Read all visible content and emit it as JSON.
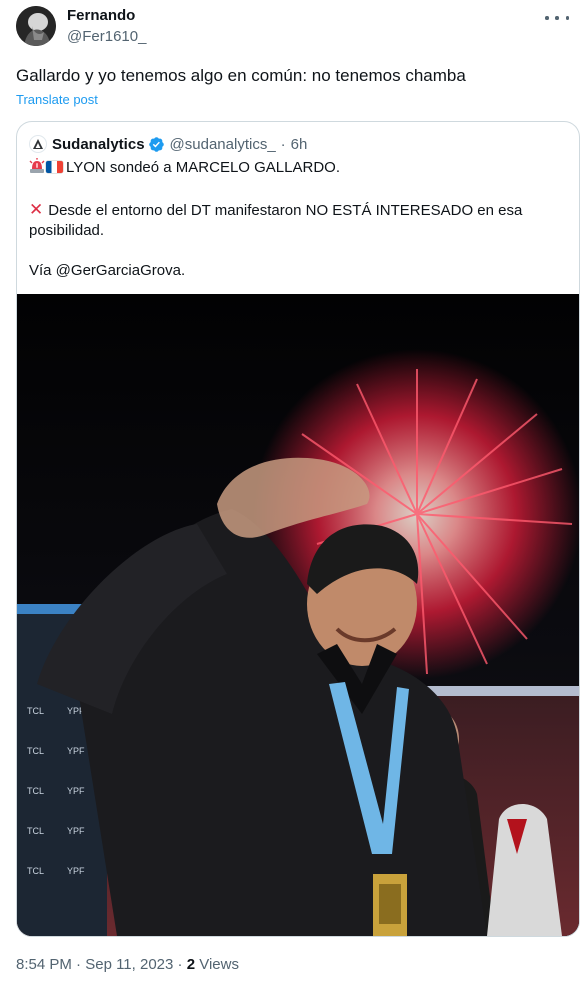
{
  "author": {
    "name": "Fernando",
    "handle": "@Fer1610_"
  },
  "post": {
    "text": "Gallardo y yo tenemos algo en común: no tenemos chamba",
    "translate_label": "Translate post"
  },
  "quote": {
    "name": "Sudanalytics",
    "handle": "@sudanalytics_",
    "separator": "·",
    "time": "6h",
    "line1": "LYON sondeó a MARCELO GALLARDO.",
    "line2": "Desde el entorno del DT manifestaron NO ESTÁ INTERESADO en esa posibilidad.",
    "line3": "Vía @GerGarciaGrova."
  },
  "footer": {
    "time": "8:54 PM",
    "separator1": "·",
    "date": "Sep 11, 2023",
    "separator2": "·",
    "views_count": "2",
    "views_label": "Views"
  },
  "colors": {
    "accent": "#1d9bf0",
    "secondary_text": "#536471",
    "border": "#cfd9de"
  },
  "icons": [
    "more-icon",
    "verified-badge-icon",
    "siren-emoji-icon",
    "france-flag-icon",
    "cross-mark-emoji-icon"
  ]
}
